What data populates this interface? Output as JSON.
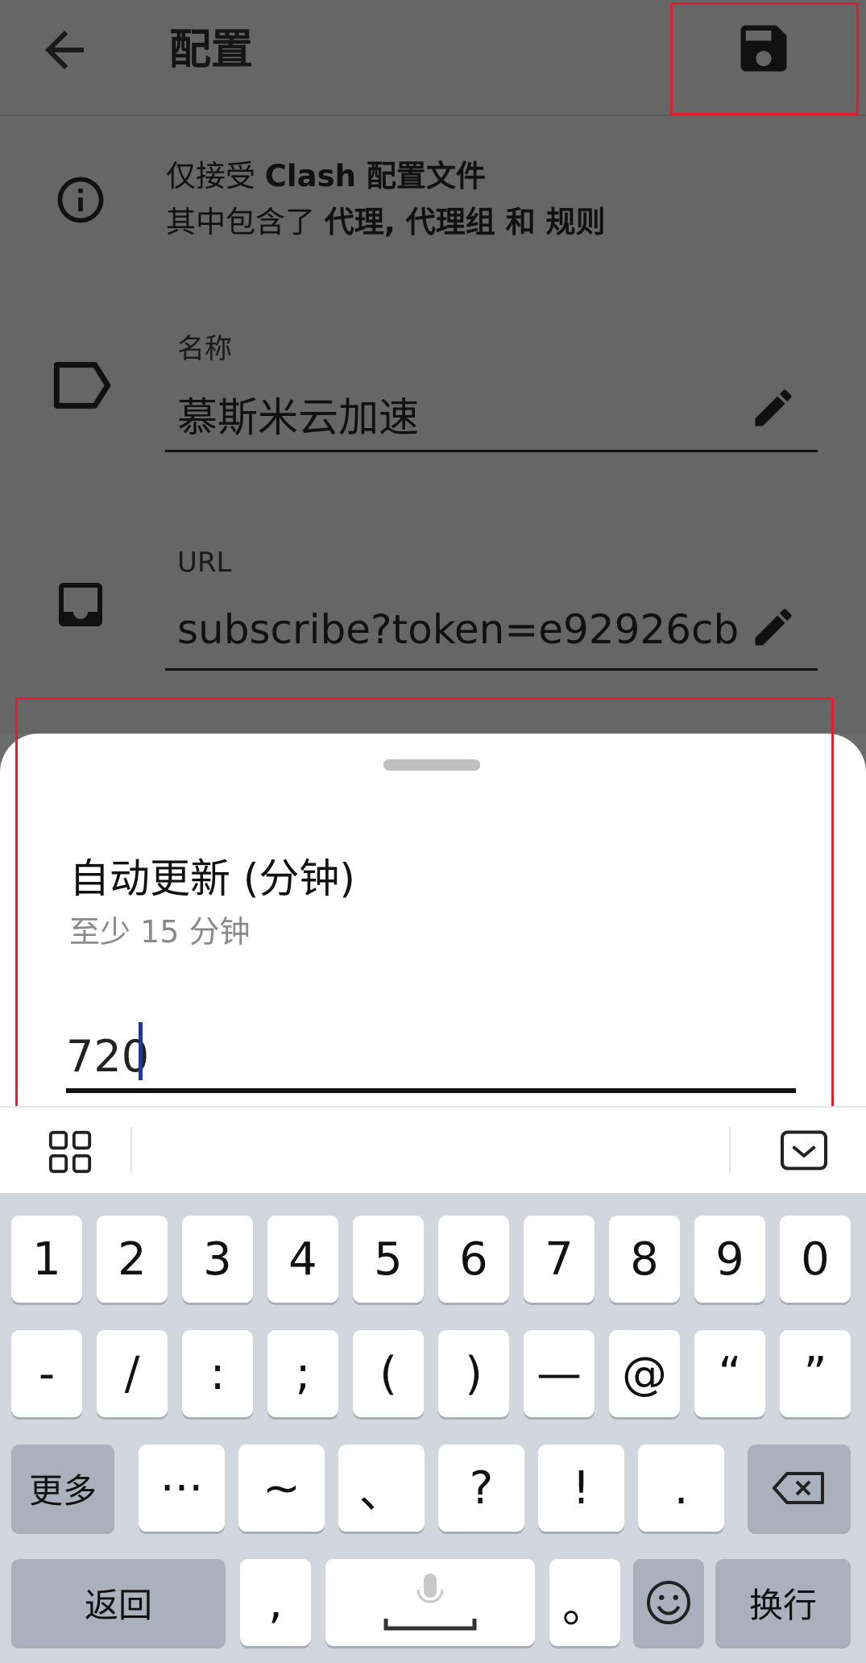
{
  "appbar": {
    "title": "配置"
  },
  "info": {
    "line1_prefix": "仅接受 ",
    "line1_bold": "Clash 配置文件",
    "line2_prefix": "其中包含了 ",
    "line2_bold": "代理, 代理组 和 规则"
  },
  "fields": {
    "name_label": "名称",
    "name_value": "慕斯米云加速",
    "url_label": "URL",
    "url_value": "subscribe?token=e92926cb…"
  },
  "sheet": {
    "title": "自动更新 (分钟)",
    "subtitle": "至少 15 分钟",
    "input_value": "720"
  },
  "keyboard": {
    "row1": [
      "1",
      "2",
      "3",
      "4",
      "5",
      "6",
      "7",
      "8",
      "9",
      "0"
    ],
    "row2": [
      "-",
      "/",
      ":",
      ";",
      "(",
      ")",
      "—",
      "@",
      "“",
      "”"
    ],
    "row3": [
      "更多",
      "···",
      "~",
      "、",
      "?",
      "!",
      "."
    ],
    "row4": [
      "返回",
      ",",
      "",
      "。",
      "",
      "换行"
    ]
  },
  "colors": {
    "highlight": "#e02030",
    "caret": "#1e3a8a",
    "overlay": "#666666"
  }
}
